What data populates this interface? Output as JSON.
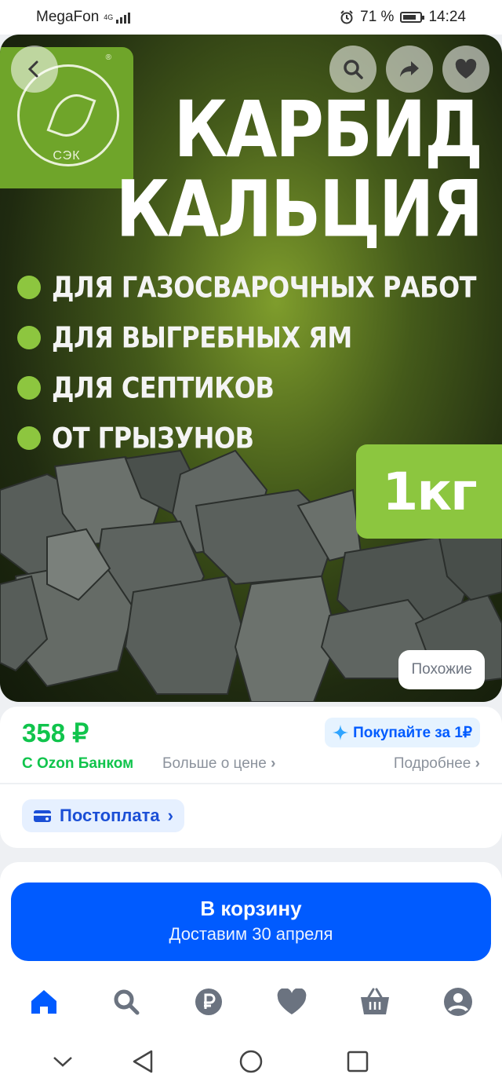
{
  "status_bar": {
    "carrier": "MegaFon",
    "network": "4G",
    "battery": "71 %",
    "time": "14:24"
  },
  "product_image": {
    "brand_logo_text": "СЭК",
    "title_line1": "КАРБИД",
    "title_line2": "КАЛЬЦИЯ",
    "bullets": [
      "ДЛЯ ГАЗОСВАРОЧНЫХ РАБОТ",
      "ДЛЯ ВЫГРЕБНЫХ ЯМ",
      "ДЛЯ СЕПТИКОВ",
      "ОТ ГРЫЗУНОВ"
    ],
    "weight": "1кг",
    "similar_label": "Похожие"
  },
  "price_block": {
    "price": "358 ₽",
    "promo_label": "Покупайте за 1₽",
    "ozon_bank_label": "С Ozon Банком",
    "more_about_price": "Больше о цене",
    "details_label": "Подробнее",
    "postpay_label": "Постоплата"
  },
  "cart": {
    "button_label": "В корзину",
    "delivery_text": "Доставим 30 апреля"
  },
  "tab_bar": [
    "home-icon",
    "search-icon",
    "ruble-icon",
    "heart-icon",
    "basket-icon",
    "profile-icon"
  ],
  "colors": {
    "accent_blue": "#005bff",
    "price_green": "#10c44c",
    "brand_green": "#8cc63f"
  }
}
